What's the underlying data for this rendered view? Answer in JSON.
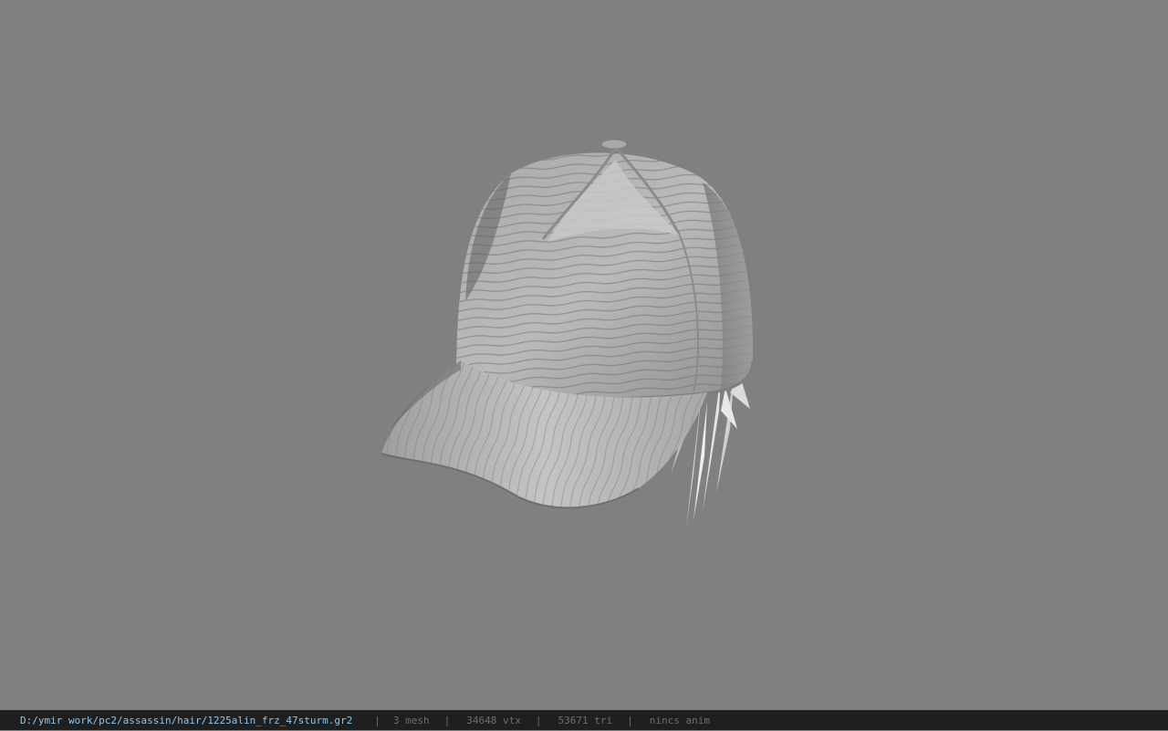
{
  "viewport": {
    "background_color": "#808080",
    "model_name": "baseball-cap-with-hair"
  },
  "statusbar": {
    "file_path": "D:/ymir work/pc2/assassin/hair/1225alin_frz_47sturm.gr2",
    "separator": "|",
    "mesh_count": "3 mesh",
    "vertex_count": "34648 vtx",
    "triangle_count": "53671 tri",
    "anim_status": "nincs anim",
    "path_color": "#8ec7ef",
    "info_color": "#6e6e6e"
  }
}
